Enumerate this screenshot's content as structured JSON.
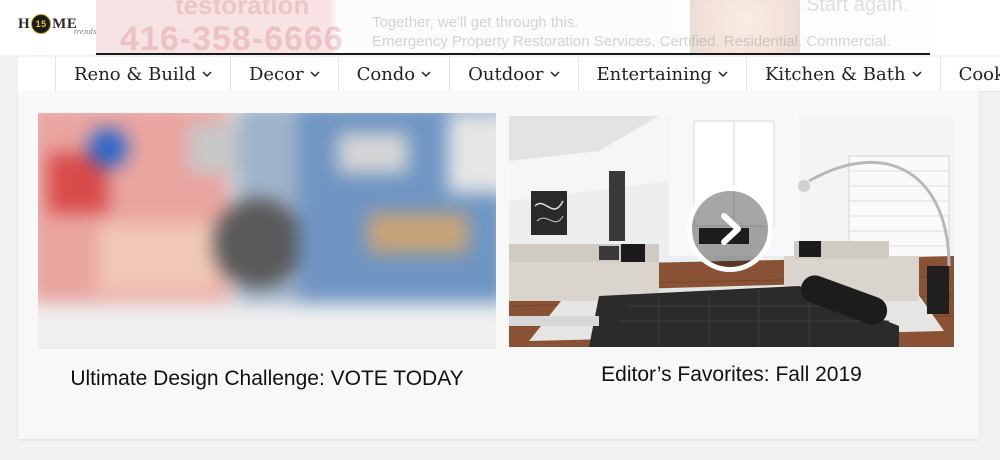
{
  "header": {
    "logo_text_left": "H",
    "logo_badge": "15",
    "logo_text_right": "ME",
    "logo_subtext": "trends",
    "ad": {
      "brand": "testoration",
      "phone": "416-358-6666",
      "line1": "Together, we'll get through this.",
      "line2": "Emergency Property Restoration Services. Certified. Residential. Commercial.",
      "cta": "Start again."
    }
  },
  "nav": {
    "items": [
      {
        "label": "Reno & Build"
      },
      {
        "label": "Decor"
      },
      {
        "label": "Condo"
      },
      {
        "label": "Outdoor"
      },
      {
        "label": "Entertaining"
      },
      {
        "label": "Kitchen & Bath"
      },
      {
        "label": "Cooking"
      }
    ],
    "chevron_icon": "chevron-down-icon"
  },
  "articles": [
    {
      "title": "Ultimate Design Challenge: VOTE TODAY",
      "image": "blurred-design-collage"
    },
    {
      "title": "Editor’s Favorites: Fall 2019",
      "image": "living-room-photo",
      "overlay_icon": "play-arrow-icon"
    }
  ],
  "colors": {
    "page_bg": "#f2f2f2",
    "card_bg": "#f8f8f8",
    "nav_text": "#222222",
    "logo_accent": "#c9a227"
  }
}
